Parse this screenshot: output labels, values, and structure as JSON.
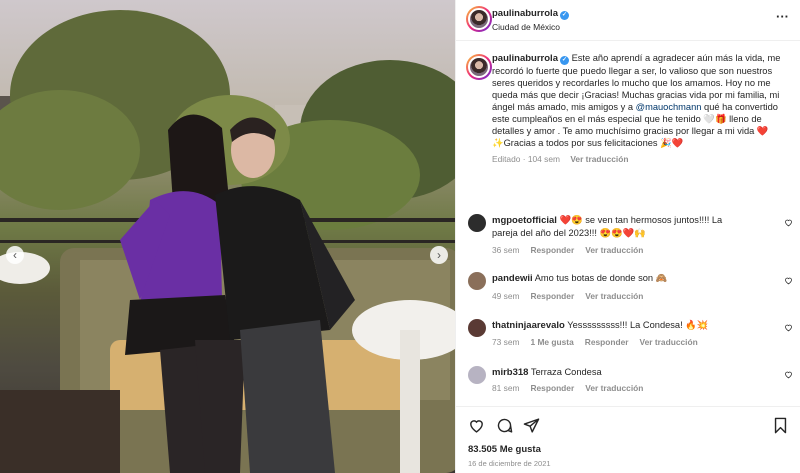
{
  "post": {
    "author": "paulinaburrola",
    "location": "Ciudad de México",
    "caption_segments": [
      {
        "text": "Este año aprendí a agradecer aún más la vida, me recordó lo fuerte que puedo llegar a ser, lo valioso que son nuestros seres queridos y recordarles lo mucho que los amamos. Hoy no me queda más que decir ¡Gracias! Muchas gracias vida por mi familia, mi ángel más amado, mis amigos y a "
      },
      {
        "text": "@mauochmann",
        "mention": true
      },
      {
        "text": " qué ha convertido este cumpleaños en el más especial que he tenido 🤍🎁 lleno de detalles y amor . Te amo muchísimo gracias por llegar a mi vida ❤️\n✨Gracias a todos por sus felicitaciones 🎉❤️"
      }
    ],
    "edited_label": "Editado",
    "age": "104 sem",
    "translate_label": "Ver traducción",
    "likes": "83.505 Me gusta",
    "date": "16 de diciembre de 2021"
  },
  "comments": [
    {
      "user": "mgpoetofficial",
      "text": "❤️😍 se ven tan hermosos juntos!!!! La pareja del año del 2023!!! 😍😍❤️🙌",
      "age": "36 sem",
      "likes": "",
      "reply": "Responder",
      "translate": "Ver traducción"
    },
    {
      "user": "pandewii",
      "text": "Amo tus botas de donde son 🙈",
      "age": "49 sem",
      "likes": "",
      "reply": "Responder",
      "translate": "Ver traducción"
    },
    {
      "user": "thatninjaarevalo",
      "text": "Yesssssssss!!! La Condesa! 🔥💥",
      "age": "73 sem",
      "likes": "1 Me gusta",
      "reply": "Responder",
      "translate": "Ver traducción"
    },
    {
      "user": "mirb318",
      "text": "Terraza Condesa",
      "age": "81 sem",
      "likes": "",
      "reply": "Responder",
      "translate": "Ver traducción"
    }
  ],
  "icons": {
    "header_more": "more-horizontal-icon",
    "verified": "verified-badge-icon",
    "carousel_prev": "chevron-left-icon",
    "carousel_next": "chevron-right-icon",
    "like": "heart-icon",
    "comment": "comment-icon",
    "share": "send-icon",
    "save": "bookmark-icon"
  },
  "colors": {
    "verified": "#3897f0",
    "mention": "#00376b",
    "muted": "#8e8e8e",
    "outfit": "#6a2fa4"
  }
}
